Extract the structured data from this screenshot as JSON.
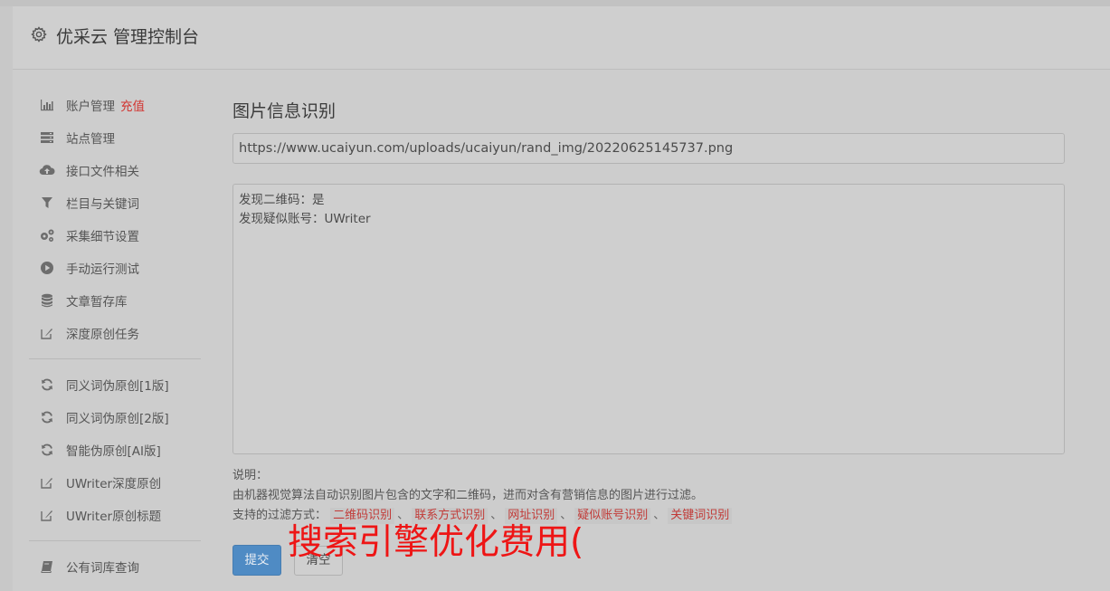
{
  "header": {
    "title": "优采云 管理控制台",
    "icon": "gear-icon"
  },
  "sidebar": {
    "items": [
      {
        "label": "账户管理",
        "badge": "充值",
        "icon": "bar-chart-icon"
      },
      {
        "label": "站点管理",
        "icon": "server-icon"
      },
      {
        "label": "接口文件相关",
        "icon": "cloud-upload-icon"
      },
      {
        "label": "栏目与关键词",
        "icon": "filter-icon"
      },
      {
        "label": "采集细节设置",
        "icon": "gears-icon"
      },
      {
        "label": "手动运行测试",
        "icon": "play-circle-icon"
      },
      {
        "label": "文章暂存库",
        "icon": "database-icon"
      },
      {
        "label": "深度原创任务",
        "icon": "edit-icon"
      },
      {
        "label": "同义词伪原创[1版]",
        "icon": "refresh-icon"
      },
      {
        "label": "同义词伪原创[2版]",
        "icon": "refresh-icon"
      },
      {
        "label": "智能伪原创[AI版]",
        "icon": "refresh-icon"
      },
      {
        "label": "UWriter深度原创",
        "icon": "edit-icon"
      },
      {
        "label": "UWriter原创标题",
        "icon": "edit-icon"
      },
      {
        "label": "公有词库查询",
        "icon": "book-icon"
      }
    ],
    "badge_color": "#d2332f"
  },
  "main": {
    "title": "图片信息识别",
    "url_value": "https://www.ucaiyun.com/uploads/ucaiyun/rand_img/20220625145737.png",
    "result_lines": [
      "发现二维码：是",
      "发现疑似账号：UWriter"
    ],
    "notes": {
      "label": "说明：",
      "description": "由机器视觉算法自动识别图片包含的文字和二维码，进而对含有营销信息的图片进行过滤。",
      "filters_label": "支持的过滤方式：",
      "filters": [
        "二维码识别",
        "联系方式识别",
        "网址识别",
        "疑似账号识别",
        "关键词识别"
      ],
      "separator": "、"
    },
    "submit_label": "提交",
    "clear_label": "清空"
  },
  "overlay": {
    "text": "搜索引擎优化费用(",
    "color": "#ee1515"
  },
  "colors": {
    "accent": "#4f8bc4",
    "highlight": "#c23a37"
  }
}
